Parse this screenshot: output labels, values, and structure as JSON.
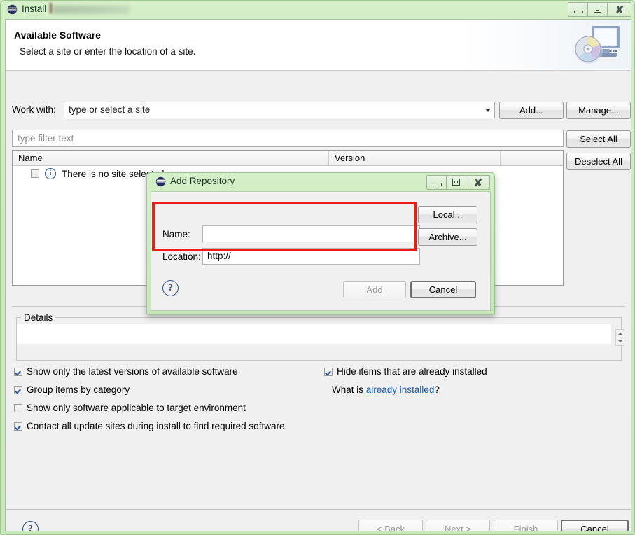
{
  "window": {
    "title": "Install",
    "icon": "eclipse-icon",
    "buttons": {
      "minimize": "minimize-icon",
      "maximize": "maximize-icon",
      "close": "close-icon"
    }
  },
  "header": {
    "title": "Available Software",
    "subtitle": "Select a site or enter the location of a site.",
    "icon": "install-monitor-cd-icon"
  },
  "work_with": {
    "label": "Work with:",
    "value": "type or select a site",
    "dropdown_icon": "chevron-down-icon",
    "add_label": "Add...",
    "manage_label": "Manage..."
  },
  "filter": {
    "placeholder": "type filter text",
    "select_all_label": "Select All",
    "deselect_all_label": "Deselect All"
  },
  "table": {
    "columns": [
      "Name",
      "Version",
      ""
    ],
    "rows": [
      {
        "checked": false,
        "icon": "info-icon",
        "name": "There is no site selected.",
        "version": ""
      }
    ]
  },
  "details": {
    "legend": "Details",
    "value": "",
    "scroll_up_icon": "caret-up-icon",
    "scroll_down_icon": "caret-down-icon"
  },
  "options": {
    "left": [
      {
        "label": "Show only the latest versions of available software",
        "checked": true
      },
      {
        "label": "Group items by category",
        "checked": true
      },
      {
        "label": "Show only software applicable to target environment",
        "checked": false
      },
      {
        "label": "Contact all update sites during install to find required software",
        "checked": true
      }
    ],
    "right": [
      {
        "label": "Hide items that are already installed",
        "checked": true
      }
    ],
    "what_is_prefix": "What is ",
    "what_is_link": "already installed",
    "what_is_suffix": "?"
  },
  "wizard_buttons": {
    "help_icon": "help-icon",
    "back": "< Back",
    "next": "Next >",
    "finish": "Finish",
    "cancel": "Cancel"
  },
  "modal": {
    "title": "Add Repository",
    "icon": "eclipse-icon",
    "buttons": {
      "minimize": "minimize-icon",
      "maximize": "maximize-icon",
      "close": "close-icon"
    },
    "name_label": "Name:",
    "name_value": "",
    "location_label": "Location:",
    "location_value": "http://",
    "local_label": "Local...",
    "archive_label": "Archive...",
    "help_icon": "help-icon",
    "add_label": "Add",
    "cancel_label": "Cancel"
  },
  "annotation": {
    "highlight_color": "#ef1b11"
  },
  "colors": {
    "window_chrome": "#cfeac1",
    "client_bg": "#f0f0f0",
    "link": "#1b5fbe",
    "accent_check": "#2c5aa0"
  }
}
